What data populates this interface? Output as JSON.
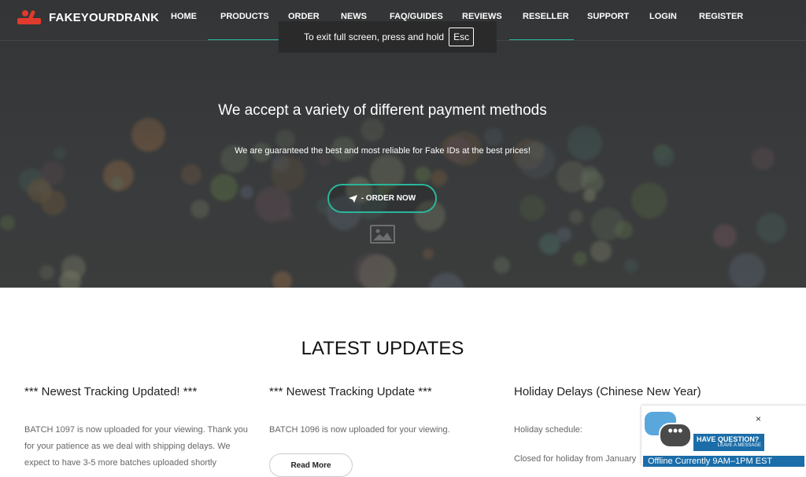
{
  "brand": {
    "name": "FAKEYOURDRANK",
    "accent": "#e03b2c"
  },
  "nav": {
    "items": [
      {
        "label": "HOME"
      },
      {
        "label": "PRODUCTS"
      },
      {
        "label": "ORDER"
      },
      {
        "label": "NEWS"
      },
      {
        "label": "FAQ/GUIDES"
      },
      {
        "label": "REVIEWS"
      },
      {
        "label": "RESELLER"
      },
      {
        "label": "SUPPORT"
      },
      {
        "label": "LOGIN"
      },
      {
        "label": "REGISTER"
      }
    ]
  },
  "fullscreen_toast": {
    "text": "To exit full screen, press and hold",
    "key": "Esc"
  },
  "hero": {
    "title": "We accept a variety of different payment methods",
    "subtitle": "We are guaranteed the best and most reliable for Fake IDs at the best prices!",
    "cta_label": "- ORDER NOW",
    "cta_icon": "paper-plane-icon",
    "accent": "#2ab59a"
  },
  "updates": {
    "heading": "LATEST UPDATES",
    "posts": [
      {
        "title": "*** Newest Tracking Updated! ***",
        "body": "BATCH 1097 is now uploaded for your viewing. Thank you for your patience as we deal with shipping delays. We expect to have 3-5 more batches uploaded shortly"
      },
      {
        "title": "*** Newest Tracking Update ***",
        "body": "BATCH 1096 is now uploaded for your viewing.",
        "read_more": "Read More"
      },
      {
        "title": "Holiday Delays (Chinese New Year)",
        "body_lines": [
          "Holiday schedule:",
          "Closed for holiday from January"
        ]
      }
    ]
  },
  "chat_widget": {
    "close": "×",
    "question": "HAVE QUESTION?",
    "leave": "LEAVE A MESSAGE",
    "status": "Offline Currently 9AM–1PM EST"
  }
}
